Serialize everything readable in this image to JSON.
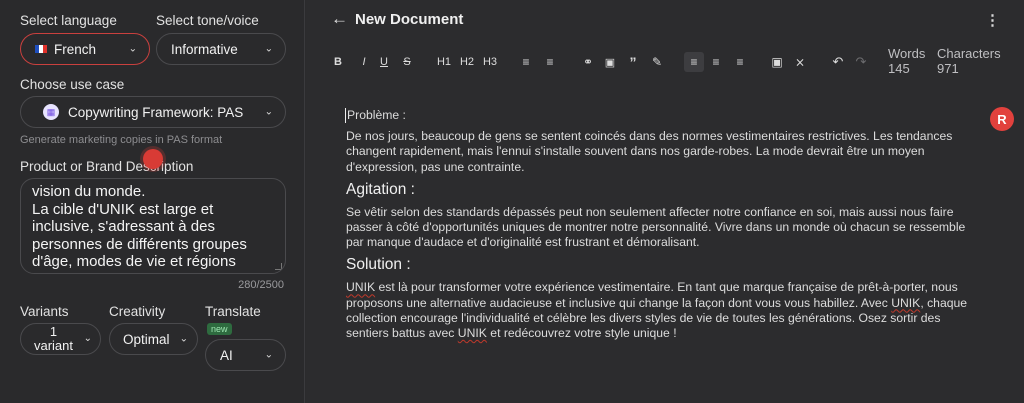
{
  "left": {
    "language_label": "Select language",
    "language_value": "French",
    "tone_label": "Select tone/voice",
    "tone_value": "Informative",
    "usecase_label": "Choose use case",
    "usecase_value": "Copywriting Framework: PAS",
    "usecase_hint": "Generate marketing copies in PAS format",
    "description_label": "Product or Brand Description",
    "description_lines": [
      "vision du monde.",
      "La cible d'UNIK est large et",
      "inclusive, s'adressant à des",
      "personnes de différents groupes",
      "d'âge, modes de vie et régions"
    ],
    "counter": "280/2500",
    "variants_label": "Variants",
    "variants_value_1": "1",
    "variants_value_2": "variant",
    "creativity_label": "Creativity",
    "creativity_value": "Optimal",
    "translate_label": "Translate",
    "translate_badge": "new",
    "translate_value": "AI"
  },
  "editor": {
    "title": "New Document",
    "toolbar": [
      "B",
      "I",
      "U",
      "S",
      "H1",
      "H2",
      "H3",
      "bulleted-list",
      "numbered-list",
      "link",
      "image",
      "quote",
      "highlighter",
      "align-left",
      "align-center",
      "align-right",
      "frame",
      "clear-format",
      "undo",
      "redo"
    ],
    "words_label": "Words",
    "words_value": "145",
    "chars_label": "Characters",
    "chars_value": "971",
    "avatar": "R",
    "heading1": "Problème :",
    "para1": "De nos jours, beaucoup de gens se sentent coincés dans des normes vestimentaires restrictives. Les tendances changent rapidement, mais l'ennui s'installe souvent dans nos garde-robes. La mode devrait être un moyen d'expression, pas une contrainte.",
    "heading2": "Agitation :",
    "para2": "Se vêtir selon des standards dépassés peut non seulement affecter notre confiance en soi, mais aussi nous faire passer à côté d'opportunités uniques de montrer notre personnalité. Vivre dans un monde où chacun se ressemble par manque d'audace et d'originalité est frustrant et démoralisant.",
    "heading3": "Solution :",
    "para3_l1": "UNIK",
    "para3_l1b": " est là pour transformer votre expérience vestimentaire. En tant que marque française de prêt-à-porter, nous proposons une alternative audacieuse et inclusive qui change la façon dont vous vous habillez. Avec ",
    "para3_l2": "UNIK",
    "para3_l2b": ", chaque collection encourage l'individualité et célèbre les divers styles de vie de toutes les générations. Osez sortir des sentiers battus avec ",
    "para3_l3": "UNIK",
    "para3_l3b": " et redécouvrez votre style unique !"
  },
  "colors": {
    "accent": "#e2413d",
    "background": "#2b2b2d"
  }
}
